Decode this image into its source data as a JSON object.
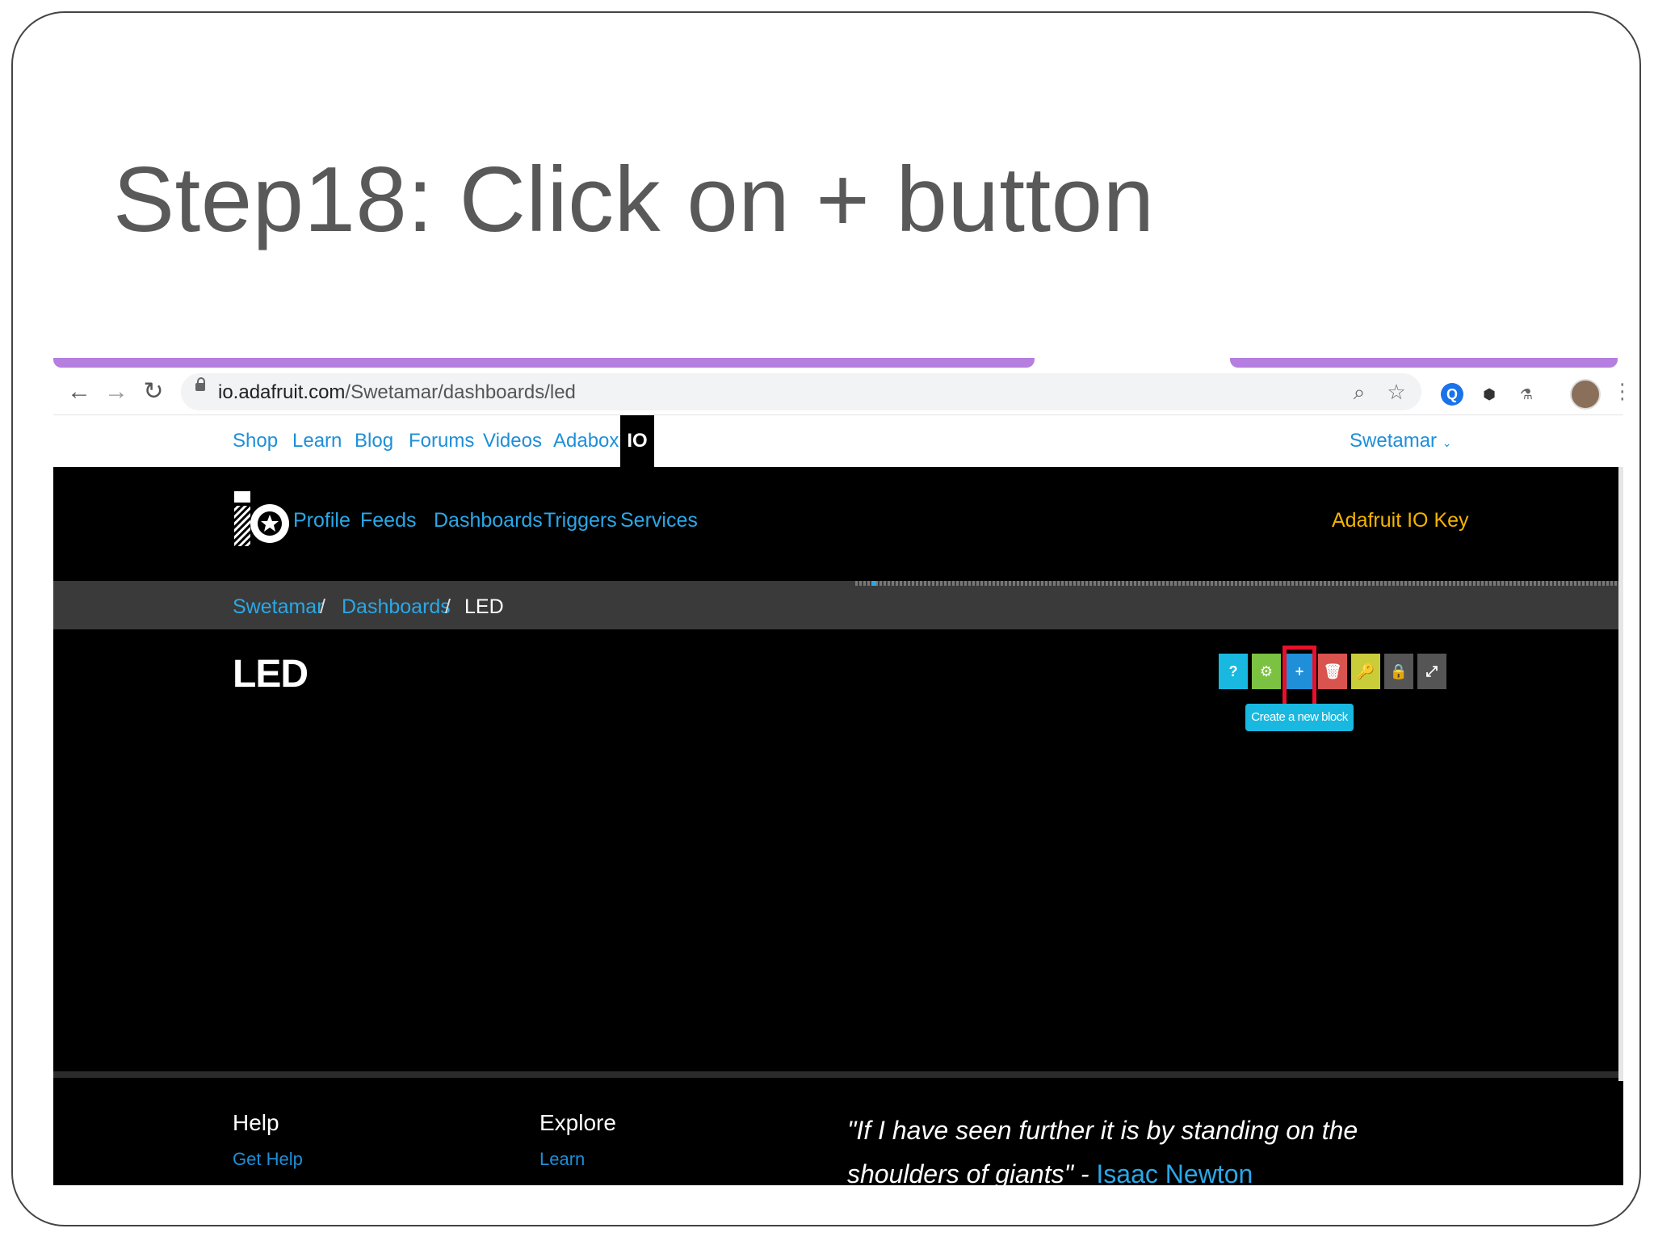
{
  "slide": {
    "title": "Step18: Click on + button"
  },
  "browser": {
    "url_domain": "io.adafruit.com",
    "url_path": "/Swetamar/dashboards/led"
  },
  "topnav": {
    "links": [
      "Shop",
      "Learn",
      "Blog",
      "Forums",
      "Videos",
      "Adabox"
    ],
    "active_tab": "IO",
    "user": "Swetamar"
  },
  "io_nav": {
    "links": [
      "Profile",
      "Feeds",
      "Dashboards",
      "Triggers",
      "Services"
    ],
    "key_link": "Adafruit IO Key"
  },
  "breadcrumb": {
    "items": [
      "Swetamar",
      "Dashboards"
    ],
    "separator": "/",
    "current": "LED"
  },
  "dashboard": {
    "title": "LED",
    "toolbar": [
      {
        "name": "help",
        "color": "#18b8e0"
      },
      {
        "name": "settings",
        "color": "#7cc242"
      },
      {
        "name": "create-block",
        "color": "#1e8fd8"
      },
      {
        "name": "delete",
        "color": "#d9534f"
      },
      {
        "name": "key",
        "color": "#c9cd3a"
      },
      {
        "name": "lock",
        "color": "#555555"
      },
      {
        "name": "fullscreen",
        "color": "#555555"
      }
    ],
    "tooltip": "Create a new block"
  },
  "footer": {
    "help_heading": "Help",
    "help_link": "Get Help",
    "explore_heading": "Explore",
    "explore_link": "Learn",
    "quote": "\"If I have seen further it is by standing on the shoulders of giants\" - ",
    "quote_author": "Isaac Newton"
  }
}
